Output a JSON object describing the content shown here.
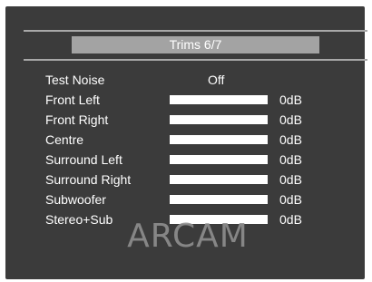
{
  "header": {
    "title": "Trims 6/7"
  },
  "menu": {
    "rows": [
      {
        "label": "Test Noise",
        "value": "Off"
      },
      {
        "label": "Front Left",
        "value": "0dB",
        "level": 1.0
      },
      {
        "label": "Front Right",
        "value": "0dB",
        "level": 1.0
      },
      {
        "label": "Centre",
        "value": "0dB",
        "level": 1.0
      },
      {
        "label": "Surround Left",
        "value": "0dB",
        "level": 1.0
      },
      {
        "label": "Surround Right",
        "value": "0dB",
        "level": 1.0
      },
      {
        "label": "Subwoofer",
        "value": "0dB",
        "level": 1.0
      },
      {
        "label": "Stereo+Sub",
        "value": "0dB",
        "level": 1.0
      }
    ]
  },
  "branding": {
    "logo": "ARCAM"
  },
  "colors": {
    "background": "#3b3b3b",
    "title_bar": "#a3a3a3",
    "text": "#ffffff",
    "bar": "#ffffff",
    "logo": "#8f8f8f"
  }
}
